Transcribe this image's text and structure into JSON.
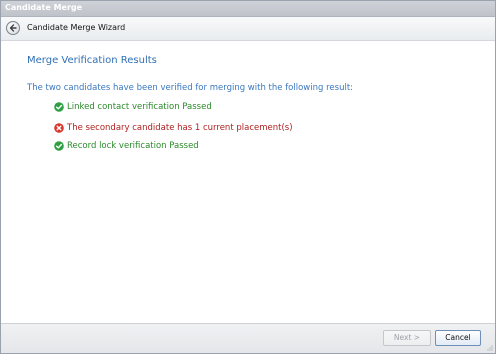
{
  "window": {
    "title": "Candidate Merge"
  },
  "wizard": {
    "title": "Candidate Merge Wizard",
    "back_icon": "back-arrow-icon"
  },
  "content": {
    "heading": "Merge Verification Results",
    "description": "The two candidates have been verified for merging with the following result:",
    "results": [
      {
        "status": "passed",
        "icon": "check-circle-icon",
        "text": "Linked contact verification Passed",
        "color": "#2c8a2c"
      },
      {
        "status": "failed",
        "icon": "error-circle-icon",
        "text": "The secondary candidate has 1 current placement(s)",
        "color": "#b02020"
      },
      {
        "status": "passed",
        "icon": "check-circle-icon",
        "text": "Record lock verification Passed",
        "color": "#2c8a2c"
      }
    ]
  },
  "footer": {
    "next_label": "Next >",
    "cancel_label": "Cancel"
  },
  "colors": {
    "accent": "#2f6fb5",
    "success": "#2c8a2c",
    "error": "#b02020"
  }
}
